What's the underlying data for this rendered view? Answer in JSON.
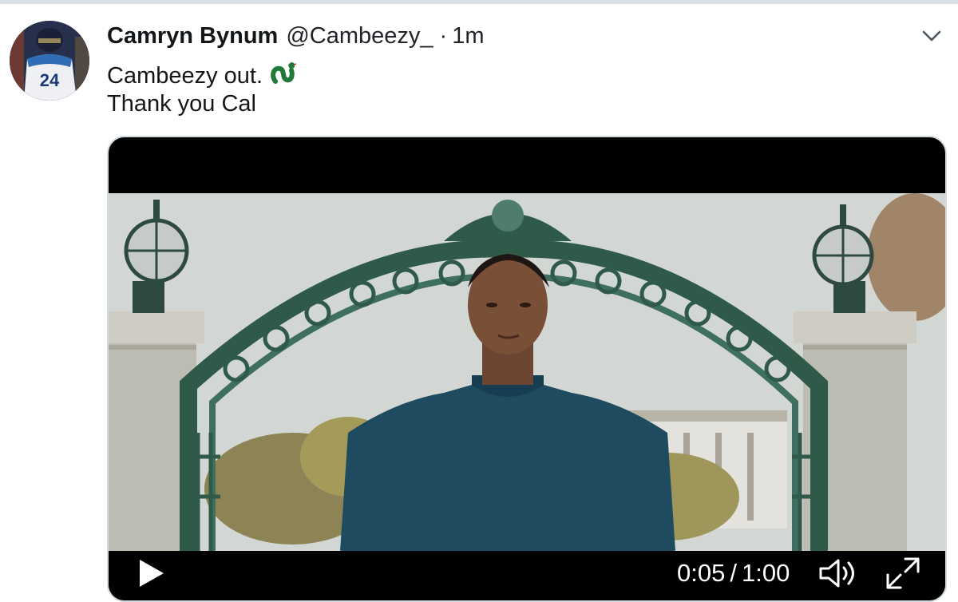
{
  "tweet": {
    "author": {
      "display_name": "Camryn Bynum",
      "handle": "@Cambeezy_",
      "avatar_jersey_number": "24"
    },
    "separator": "·",
    "timestamp": "1m",
    "text_lines": [
      "Cambeezy out.",
      "Thank you Cal"
    ],
    "emoji": "green-snake-emoji"
  },
  "media": {
    "type": "video",
    "player": {
      "current_time": "0:05",
      "time_separator": "/",
      "duration": "1:00",
      "progress_fraction": 0.083,
      "icons": {
        "play": "play-icon",
        "volume": "volume-icon",
        "fullscreen": "fullscreen-icon"
      }
    }
  },
  "colors": {
    "text": "#14171a",
    "card_border": "#cfd9de",
    "player_bg": "#000000",
    "emoji_green": "#1f7a3a"
  }
}
